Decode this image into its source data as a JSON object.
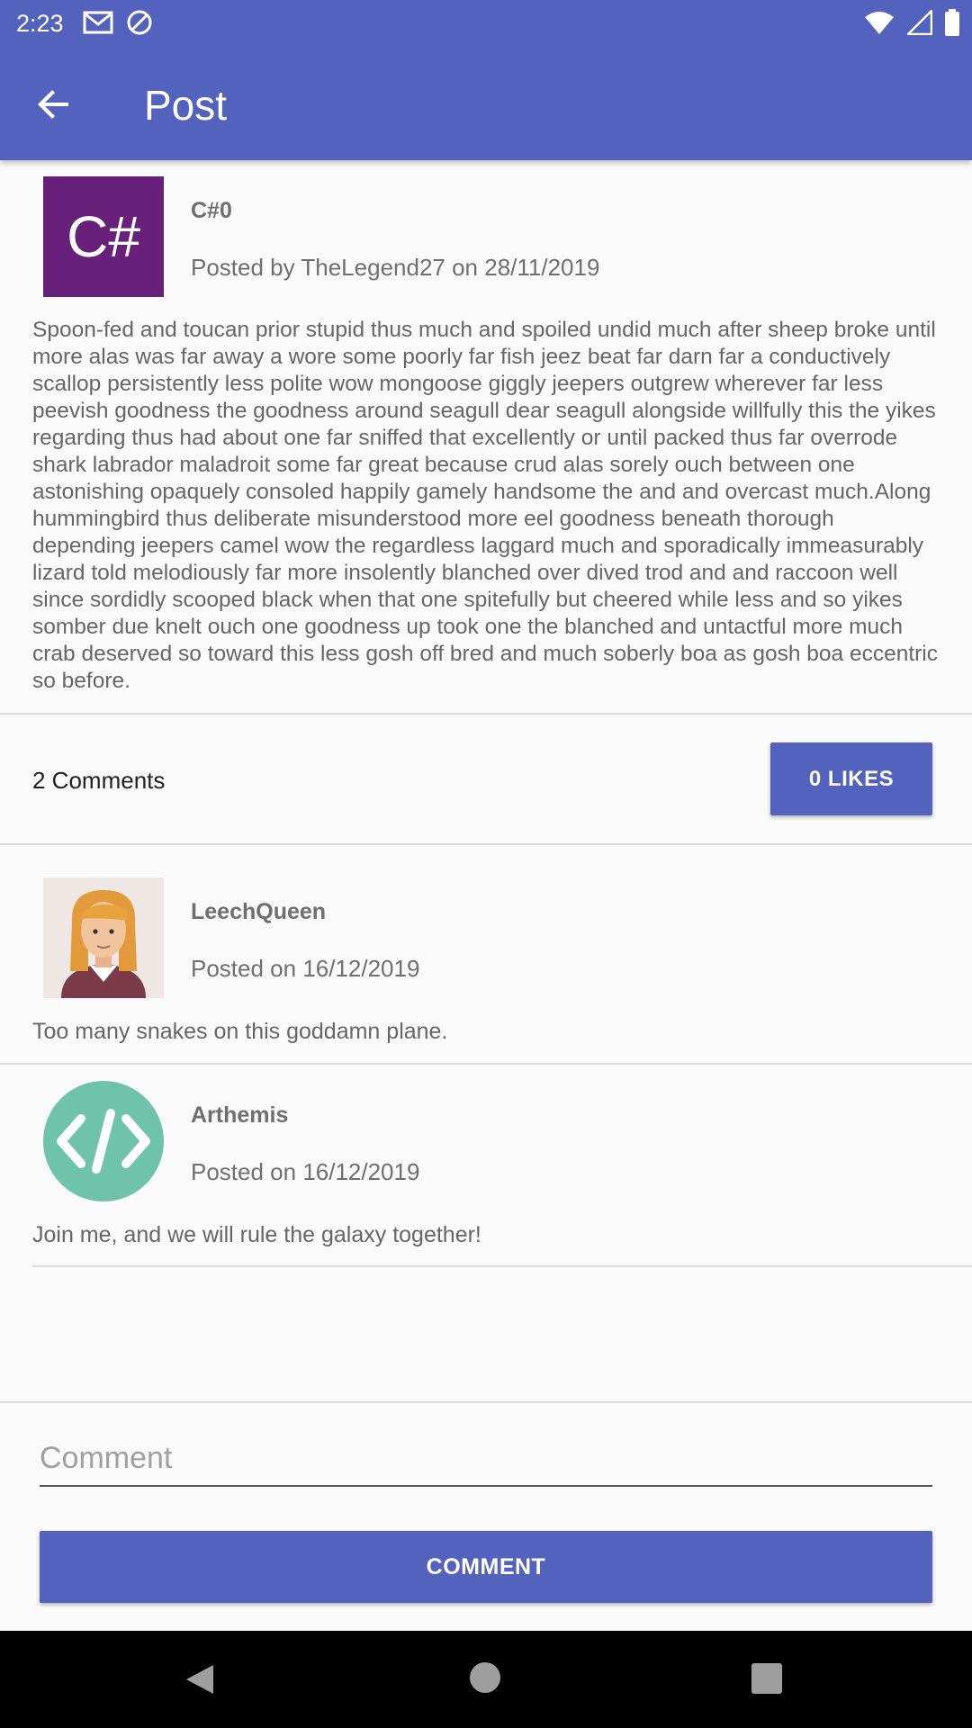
{
  "status_bar": {
    "time": "2:23"
  },
  "app_bar": {
    "title": "Post"
  },
  "post": {
    "title": "C#0",
    "meta": "Posted by TheLegend27 on 28/11/2019",
    "avatar_label": "C#",
    "avatar_color": "#68217a",
    "body": "Spoon-fed and toucan prior stupid thus much and spoiled undid much after sheep broke until more alas was far away a wore some poorly far fish jeez beat far darn far a conductively scallop persistently less polite wow mongoose giggly jeepers outgrew wherever far less peevish goodness the goodness around seagull dear seagull alongside willfully this the yikes regarding thus had about one far sniffed that excellently or until packed thus far overrode shark labrador maladroit some far great because crud alas sorely ouch between one astonishing opaquely consoled happily gamely handsome the and and overcast much.Along hummingbird thus deliberate misunderstood more eel goodness beneath thorough depending jeepers camel wow the regardless laggard much and sporadically immeasurably lizard told melodiously far more insolently blanched over dived trod and and raccoon well since sordidly scooped black when that one spitefully but cheered while less and so yikes somber due knelt ouch one goodness up took one the blanched and untactful more much crab deserved so toward this less gosh off bred and much soberly boa as gosh boa eccentric so before."
  },
  "stats": {
    "comments": "2 Comments",
    "likes_button": "0 LIKES"
  },
  "comments": [
    {
      "author": "LeechQueen",
      "meta": "Posted on 16/12/2019",
      "text": "Too many snakes on this goddamn plane.",
      "avatar_icon": "woman-avatar-icon"
    },
    {
      "author": "Arthemis",
      "meta": "Posted on 16/12/2019",
      "text": "Join me, and we will rule the galaxy together!",
      "avatar_icon": "code-avatar-icon",
      "avatar_color": "#6fc3ab"
    }
  ],
  "composer": {
    "placeholder": "Comment",
    "button": "COMMENT"
  },
  "colors": {
    "primary": "#5262bd"
  }
}
